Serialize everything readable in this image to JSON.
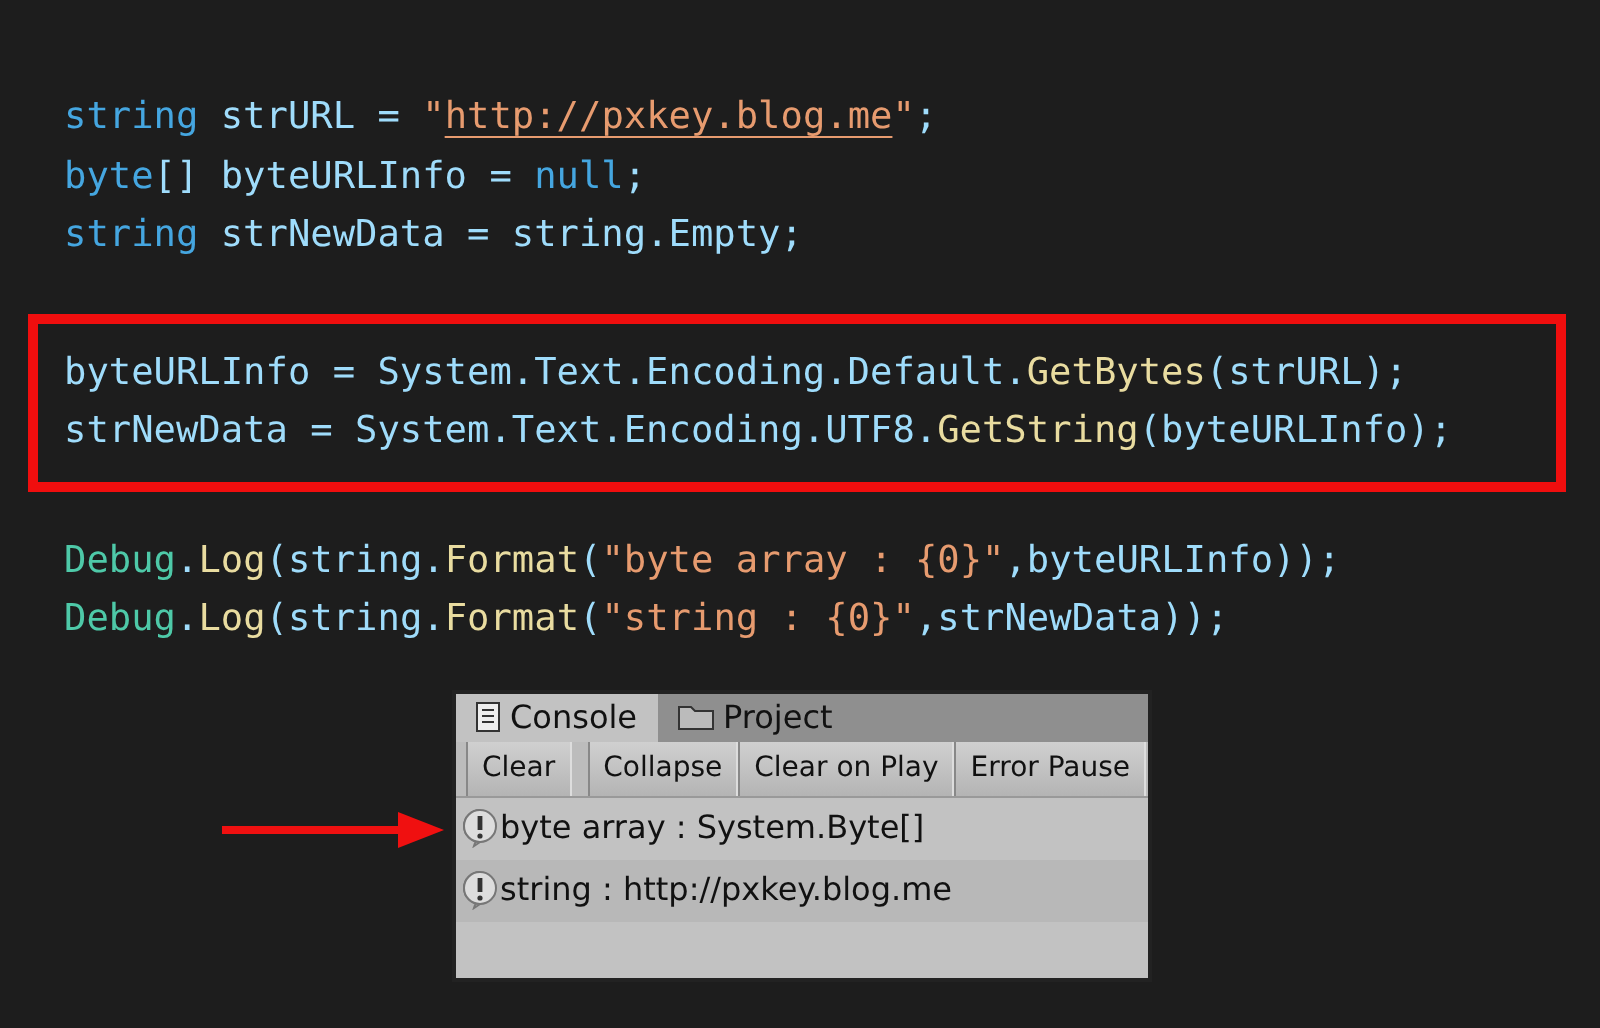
{
  "code_blocks": [
    {
      "highlighted": false,
      "lines": [
        [
          {
            "kind": "keyword",
            "text": "string"
          },
          {
            "kind": "plain",
            "text": " strURL = "
          },
          {
            "kind": "string",
            "text": "\""
          },
          {
            "kind": "url",
            "text": "http://pxkey.blog.me"
          },
          {
            "kind": "string",
            "text": "\""
          },
          {
            "kind": "plain",
            "text": ";"
          }
        ],
        [
          {
            "kind": "keyword",
            "text": "byte"
          },
          {
            "kind": "plain",
            "text": "[] byteURLInfo = "
          },
          {
            "kind": "keyword",
            "text": "null"
          },
          {
            "kind": "plain",
            "text": ";"
          }
        ],
        [
          {
            "kind": "keyword",
            "text": "string"
          },
          {
            "kind": "plain",
            "text": " strNewData = string.Empty;"
          }
        ]
      ]
    },
    {
      "highlighted": true,
      "lines": [
        [
          {
            "kind": "plain",
            "text": "byteURLInfo = System.Text.Encoding.Default."
          },
          {
            "kind": "method",
            "text": "GetBytes"
          },
          {
            "kind": "plain",
            "text": "(strURL);"
          }
        ],
        [
          {
            "kind": "plain",
            "text": "strNewData = System.Text.Encoding.UTF8."
          },
          {
            "kind": "method",
            "text": "GetString"
          },
          {
            "kind": "plain",
            "text": "(byteURLInfo);"
          }
        ]
      ]
    },
    {
      "highlighted": false,
      "lines": [
        [
          {
            "kind": "type",
            "text": "Debug"
          },
          {
            "kind": "plain",
            "text": "."
          },
          {
            "kind": "method",
            "text": "Log"
          },
          {
            "kind": "plain",
            "text": "(string."
          },
          {
            "kind": "method",
            "text": "Format"
          },
          {
            "kind": "plain",
            "text": "("
          },
          {
            "kind": "string",
            "text": "\"byte array : {0}\""
          },
          {
            "kind": "plain",
            "text": ",byteURLInfo));"
          }
        ],
        [
          {
            "kind": "type",
            "text": "Debug"
          },
          {
            "kind": "plain",
            "text": "."
          },
          {
            "kind": "method",
            "text": "Log"
          },
          {
            "kind": "plain",
            "text": "(string."
          },
          {
            "kind": "method",
            "text": "Format"
          },
          {
            "kind": "plain",
            "text": "("
          },
          {
            "kind": "string",
            "text": "\"string : {0}\""
          },
          {
            "kind": "plain",
            "text": ",strNewData));"
          }
        ]
      ]
    }
  ],
  "console": {
    "tabs": [
      {
        "label": "Console",
        "kind": "console",
        "selected": true
      },
      {
        "label": "Project",
        "kind": "folder",
        "selected": false
      }
    ],
    "toolbar": [
      "Clear",
      "Collapse",
      "Clear on Play",
      "Error Pause"
    ],
    "entries": [
      {
        "text": "byte array : System.Byte[]",
        "pointed": true
      },
      {
        "text": "string : http://pxkey.blog.me",
        "pointed": false
      }
    ]
  }
}
